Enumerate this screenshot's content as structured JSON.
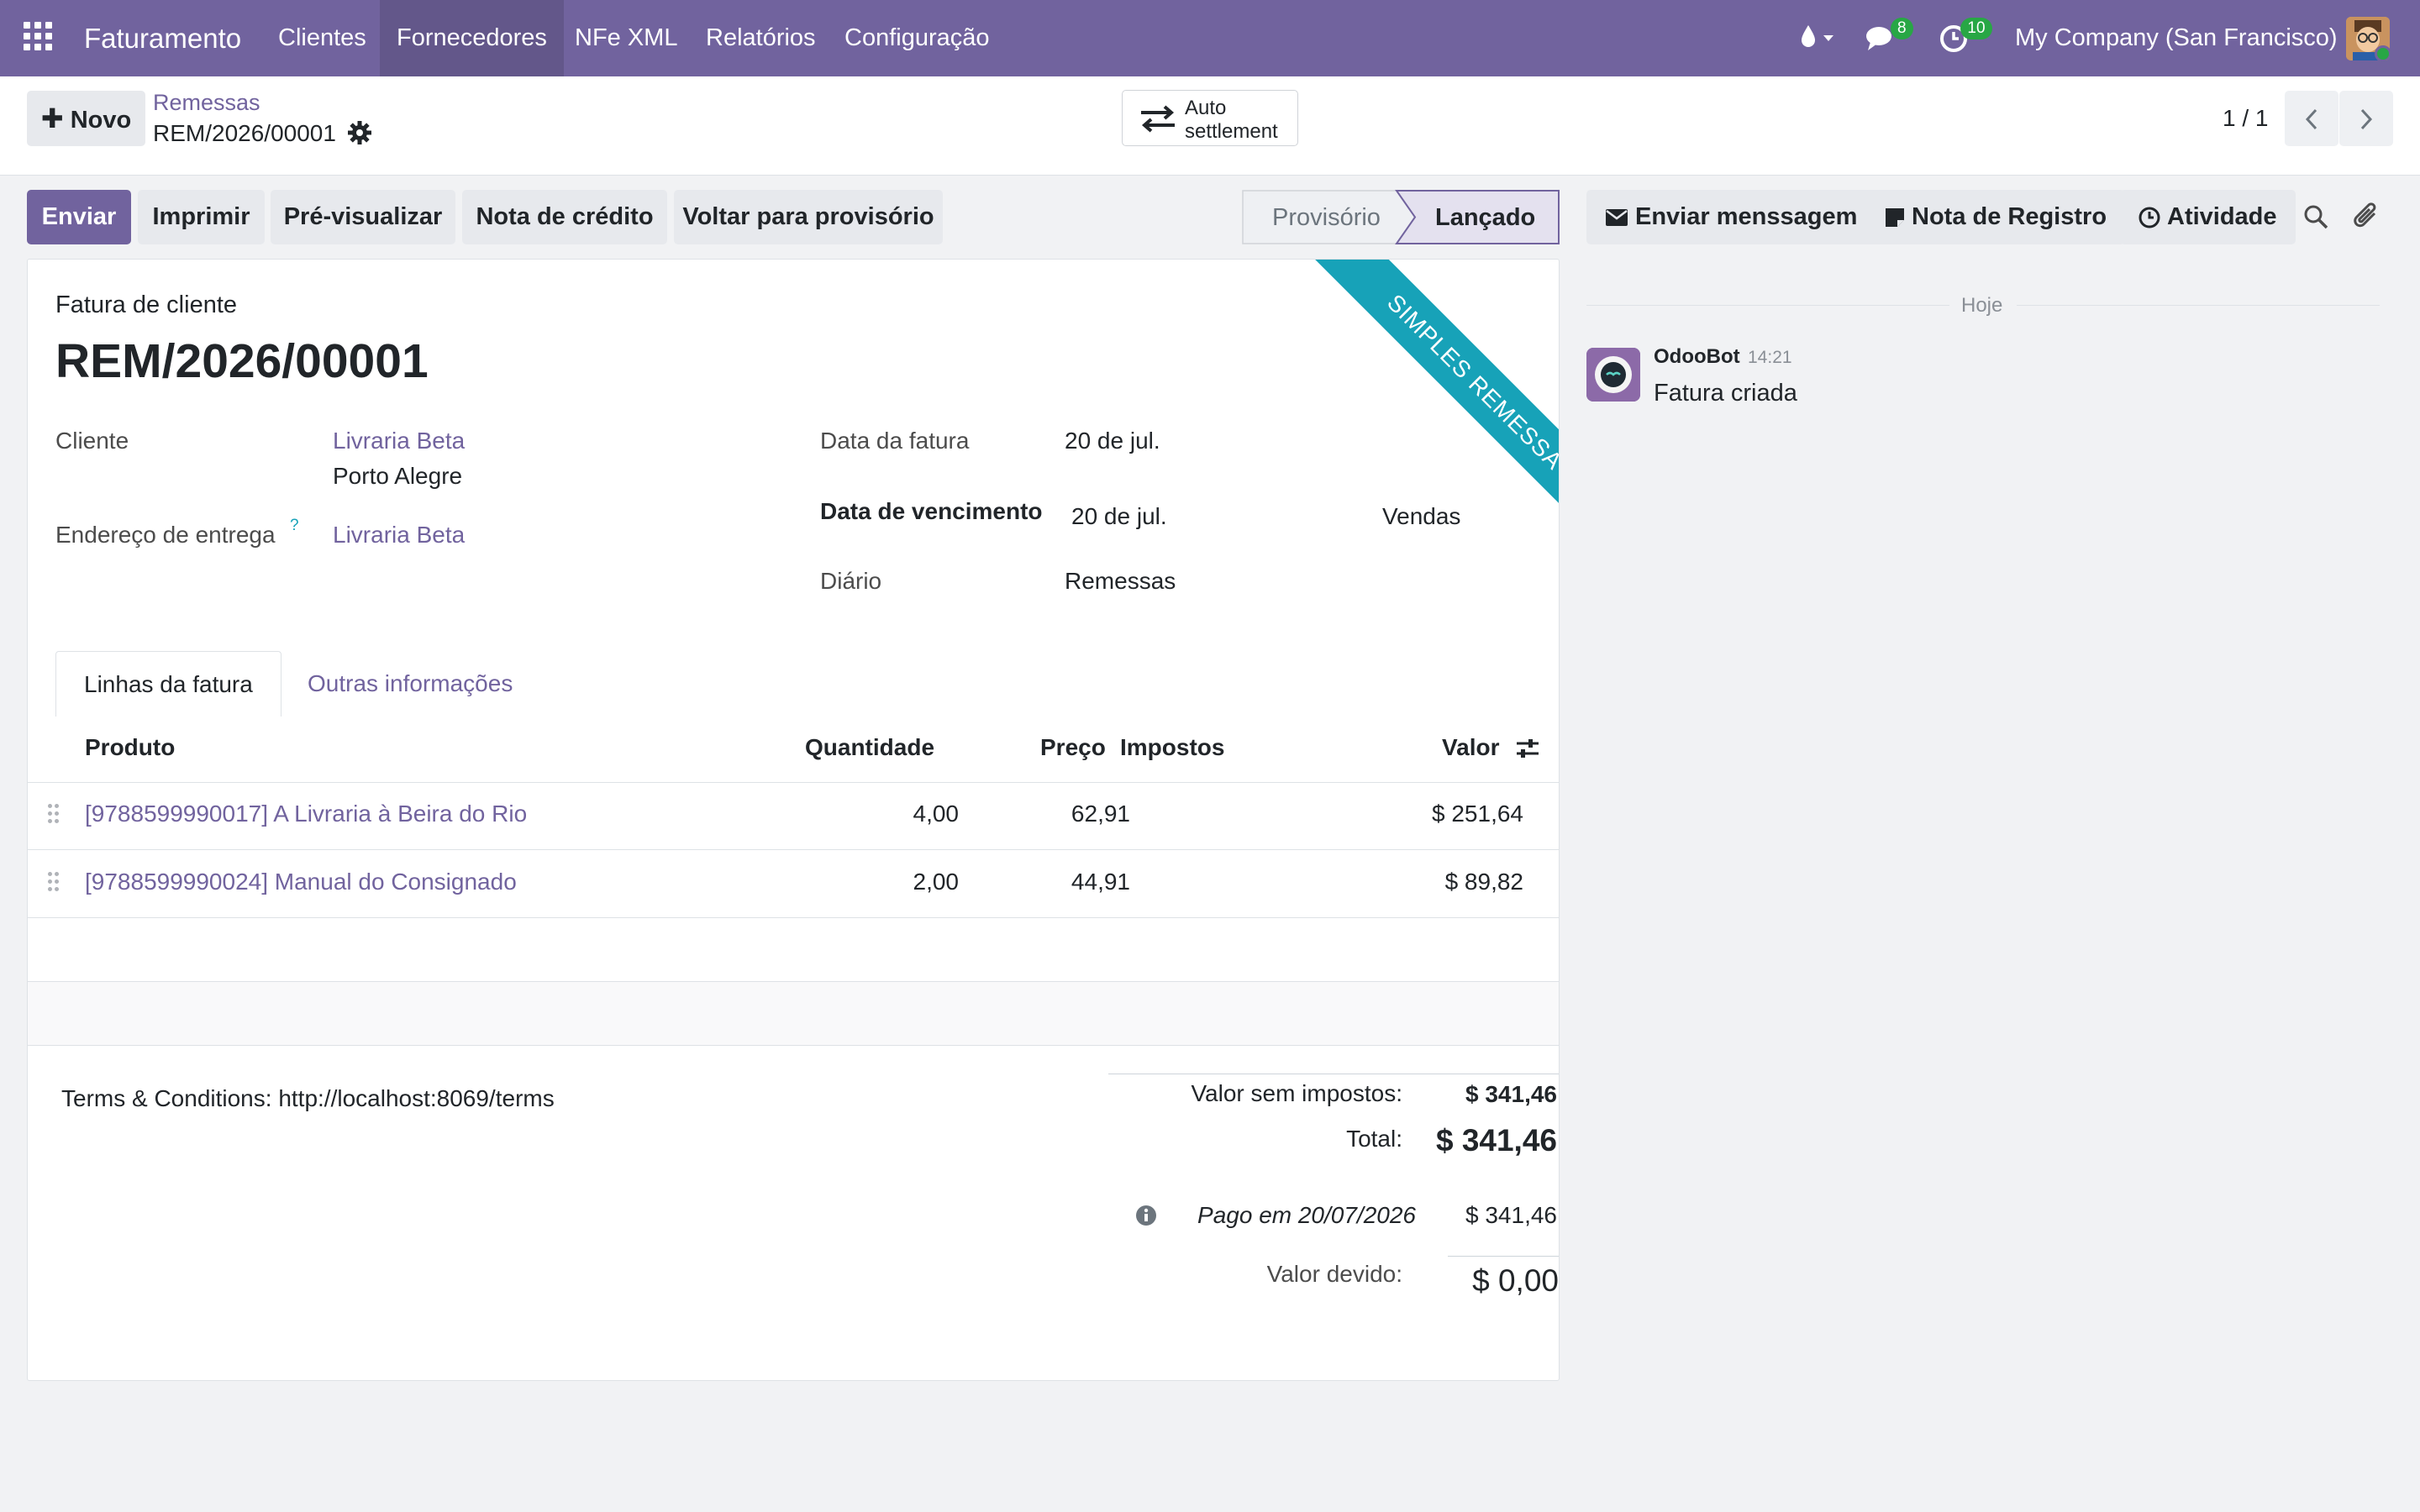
{
  "navbar": {
    "brand": "Faturamento",
    "menu": [
      "Clientes",
      "Fornecedores",
      "NFe XML",
      "Relatórios",
      "Configuração"
    ],
    "active_menu": "Fornecedores",
    "messages_count": "8",
    "activities_count": "10",
    "company": "My Company (San Francisco)"
  },
  "control": {
    "new_label": "Novo",
    "breadcrumb_parent": "Remessas",
    "record_name": "REM/2026/00001",
    "auto_settlement_line1": "Auto",
    "auto_settlement_line2": "settlement",
    "pager": "1 / 1"
  },
  "actions": {
    "send": "Enviar",
    "print": "Imprimir",
    "preview": "Pré-visualizar",
    "credit_note": "Nota de crédito",
    "reset_draft": "Voltar para provisório"
  },
  "status": {
    "steps": [
      "Provisório",
      "Lançado"
    ],
    "current": "Lançado"
  },
  "form": {
    "doc_type": "Fatura de cliente",
    "number": "REM/2026/00001",
    "ribbon": "SIMPLES REMESSA",
    "customer_label": "Cliente",
    "customer_name": "Livraria Beta",
    "customer_city": "Porto Alegre",
    "delivery_label": "Endereço de entrega",
    "delivery_help": "?",
    "delivery_value": "Livraria Beta",
    "invoice_date_label": "Data da fatura",
    "invoice_date": "20 de jul.",
    "due_date_label": "Data de vencimento",
    "due_date": "20 de jul.",
    "sales_label": "Vendas",
    "journal_label": "Diário",
    "journal": "Remessas"
  },
  "tabs": [
    "Linhas da fatura",
    "Outras informações"
  ],
  "lines": {
    "headers": {
      "product": "Produto",
      "qty": "Quantidade",
      "price": "Preço",
      "taxes": "Impostos",
      "amount": "Valor"
    },
    "rows": [
      {
        "product": "[9788599990017] A Livraria à Beira do Rio",
        "qty": "4,00",
        "price": "62,91",
        "taxes": "",
        "amount": "$ 251,64"
      },
      {
        "product": "[9788599990024] Manual do Consignado",
        "qty": "2,00",
        "price": "44,91",
        "taxes": "",
        "amount": "$ 89,82"
      }
    ]
  },
  "footer": {
    "terms": "Terms & Conditions: http://localhost:8069/terms",
    "untaxed_label": "Valor sem impostos:",
    "untaxed_value": "$ 341,46",
    "total_label": "Total:",
    "total_value": "$ 341,46",
    "paid_label": "Pago em 20/07/2026",
    "paid_value": "$ 341,46",
    "due_label": "Valor devido:",
    "due_value": "$ 0,00"
  },
  "chatter": {
    "send_message": "Enviar menssagem",
    "log_note": "Nota de Registro",
    "activity": "Atividade",
    "date_separator": "Hoje",
    "author": "OdooBot",
    "time": "14:21",
    "message": "Fatura criada"
  },
  "colors": {
    "brand": "#71639e",
    "ribbon": "#17a2b8",
    "badge": "#28a745"
  }
}
